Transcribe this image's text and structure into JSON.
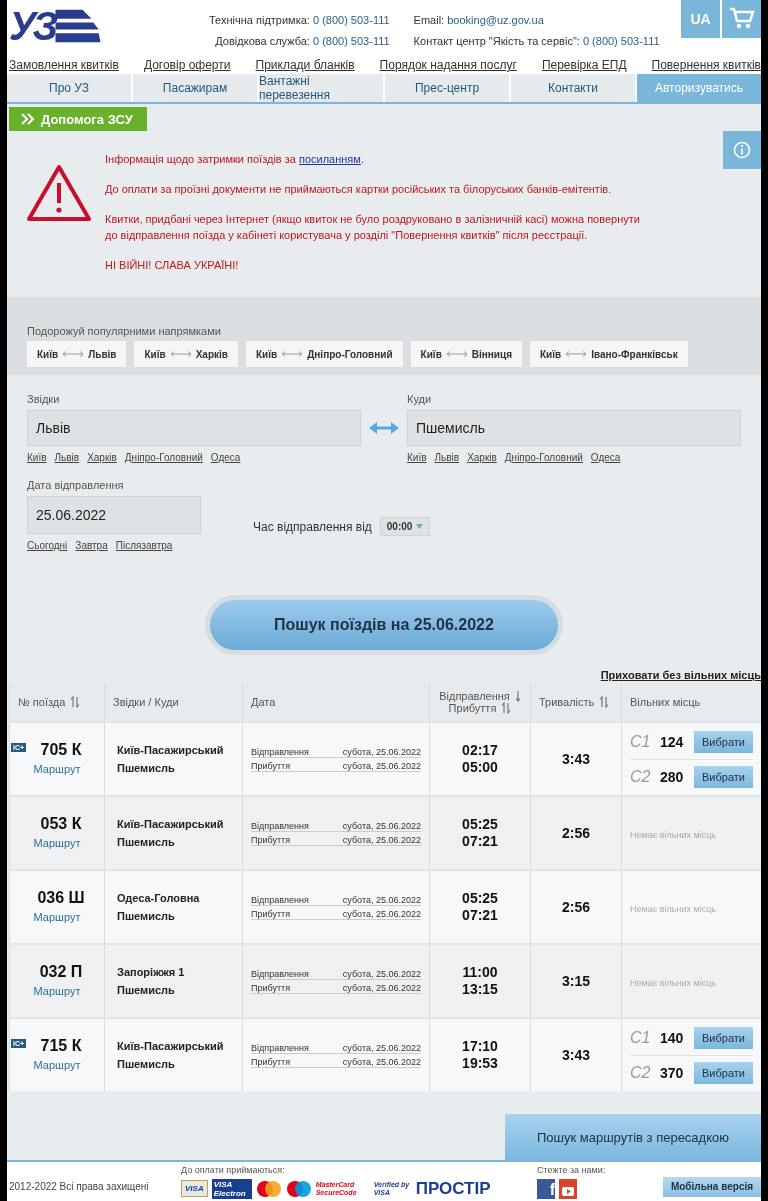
{
  "logo": {
    "text": "УЗ"
  },
  "contacts": [
    {
      "label": "Технічна підтримка:",
      "value": "0 (800) 503-111"
    },
    {
      "label": "Довідкова служба:",
      "value": "0 (800) 503-111"
    },
    {
      "label": "Email:",
      "value": "booking@uz.gov.ua"
    },
    {
      "label": "Контакт центр \"Якість та сервіс\":",
      "value": "0 (800) 503-111"
    }
  ],
  "language": "UA",
  "top_links": [
    "Замовлення квитків",
    "Договір оферти",
    "Приклади бланків",
    "Порядок надання послуг",
    "Перевірка ЕПД",
    "Повернення квитків"
  ],
  "nav": [
    {
      "label": "Про УЗ",
      "selected": false
    },
    {
      "label": "Пасажирам",
      "selected": false
    },
    {
      "label": "Вантажні перевезення",
      "selected": false
    },
    {
      "label": "Прес-центр",
      "selected": false
    },
    {
      "label": "Контакти",
      "selected": false
    },
    {
      "label": "Авторизуватись",
      "selected": true
    }
  ],
  "help_button": "Допомога ЗСУ",
  "alert": {
    "line1": "Інформація щодо затримки поїздів за",
    "link": "посиланням",
    "line1_end": ".",
    "paragraphs": [
      "До оплати за проїзні документи не приймаються картки російських та білоруських банків-емітентів.",
      "Квитки, придбані через Інтернет (якщо квиток не було роздруковано в залізничній касі) можна повернути до відправлення поїзда у кабінеті користувача у розділі \"Повернення квитків\" після реєстрації.",
      "НІ ВІЙНІ! СЛАВА УКРАЇНІ!"
    ]
  },
  "popular": {
    "title": "Подорожуй популярними напрямками",
    "routes": [
      {
        "from": "Київ",
        "to": "Львів"
      },
      {
        "from": "Київ",
        "to": "Харків"
      },
      {
        "from": "Київ",
        "to": "Дніпро-Головний"
      },
      {
        "from": "Київ",
        "to": "Вінниця"
      },
      {
        "from": "Київ",
        "to": "Івано-Франківськ"
      }
    ]
  },
  "form": {
    "from": {
      "label": "Звідки",
      "value": "Львів",
      "quick": [
        "Київ",
        "Львів",
        "Харків",
        "Дніпро-Головний",
        "Одеса"
      ]
    },
    "to": {
      "label": "Куди",
      "value": "Пшемисль",
      "quick": [
        "Київ",
        "Львів",
        "Харків",
        "Дніпро-Головний",
        "Одеса"
      ]
    },
    "date": {
      "label": "Дата відправлення",
      "value": "25.06.2022",
      "quick": [
        "Сьогодні",
        "Завтра",
        "Післязавтра"
      ]
    },
    "time": {
      "label": "Час відправлення від",
      "value": "00:00"
    }
  },
  "search_button": "Пошук поїздів на 25.06.2022",
  "hide_link": "Приховати без вільних місць",
  "table": {
    "columns": [
      "№ поїзда",
      "Звідки / Куди",
      "Дата",
      "Відправлення",
      "Прибуття",
      "Тривалість",
      "Вільних місць"
    ],
    "rows": [
      {
        "ic_plus": true,
        "badge": "IC+",
        "number": "705 К",
        "route": "Маршрут",
        "from": "Київ-Пасажирський",
        "to": "Пшемисль",
        "dep_label": "Відправлення",
        "dep_date": "субота, 25.06.2022",
        "arr_label": "Прибуття",
        "arr_date": "субота, 25.06.2022",
        "dep": "02:17",
        "arr": "05:00",
        "duration": "3:43",
        "kind": "seats",
        "seats": [
          {
            "cls": "С1",
            "count": "124",
            "button": "Вибрати"
          },
          {
            "cls": "С2",
            "count": "280",
            "button": "Вибрати"
          }
        ]
      },
      {
        "ic_plus": false,
        "number": "053 К",
        "route": "Маршрут",
        "from": "Київ-Пасажирський",
        "to": "Пшемисль",
        "dep_label": "Відправлення",
        "dep_date": "субота, 25.06.2022",
        "arr_label": "Прибуття",
        "arr_date": "субота, 25.06.2022",
        "dep": "05:25",
        "arr": "07:21",
        "duration": "2:56",
        "kind": "none",
        "none_text": "Немає вільних місць"
      },
      {
        "ic_plus": false,
        "number": "036 Ш",
        "route": "Маршрут",
        "from": "Одеса-Головна",
        "to": "Пшемисль",
        "dep_label": "Відправлення",
        "dep_date": "субота, 25.06.2022",
        "arr_label": "Прибуття",
        "arr_date": "субота, 25.06.2022",
        "dep": "05:25",
        "arr": "07:21",
        "duration": "2:56",
        "kind": "none",
        "none_text": "Немає вільних місць"
      },
      {
        "ic_plus": false,
        "number": "032 П",
        "route": "Маршрут",
        "from": "Запоріжжя 1",
        "to": "Пшемисль",
        "dep_label": "Відправлення",
        "dep_date": "субота, 25.06.2022",
        "arr_label": "Прибуття",
        "arr_date": "субота, 25.06.2022",
        "dep": "11:00",
        "arr": "13:15",
        "duration": "3:15",
        "kind": "none",
        "none_text": "Немає вільних місць"
      },
      {
        "ic_plus": true,
        "badge": "IC+",
        "number": "715 К",
        "route": "Маршрут",
        "from": "Київ-Пасажирський",
        "to": "Пшемисль",
        "dep_label": "Відправлення",
        "dep_date": "субота, 25.06.2022",
        "arr_label": "Прибуття",
        "arr_date": "субота, 25.06.2022",
        "dep": "17:10",
        "arr": "19:53",
        "duration": "3:43",
        "kind": "seats",
        "seats": [
          {
            "cls": "С1",
            "count": "140",
            "button": "Вибрати"
          },
          {
            "cls": "С2",
            "count": "370",
            "button": "Вибрати"
          }
        ]
      }
    ]
  },
  "transfer_button": "Пошук маршрутів з пересадкою",
  "footer": {
    "copyright": "2012-2022 Всі права захищені",
    "payments_title": "До оплати приймаються:",
    "payments": [
      {
        "kind": "visa",
        "text": "VISA"
      },
      {
        "kind": "visa_electron",
        "text": "VISA Electron"
      },
      {
        "kind": "mastercard"
      },
      {
        "kind": "maestro"
      },
      {
        "kind": "securecode",
        "text": "MasterCard SecureCode"
      },
      {
        "kind": "verified",
        "text": "Verified by VISA"
      },
      {
        "kind": "prostir",
        "text": "ПРОСТІР"
      }
    ],
    "social_title": "Стежте за нами:",
    "facebook": "f",
    "mobile_button": "Мобільна версія"
  }
}
